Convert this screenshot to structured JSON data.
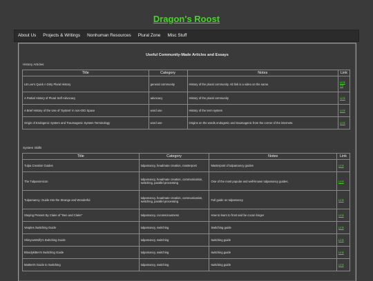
{
  "site": {
    "title": "Dragon's Roost"
  },
  "nav": [
    {
      "label": "About Us"
    },
    {
      "label": "Projects & Writings"
    },
    {
      "label": "Nonhuman Resources"
    },
    {
      "label": "Plural Zone"
    },
    {
      "label": "Misc Stuff"
    }
  ],
  "heading": "Useful Community-Made Articles and Essays",
  "history": {
    "label": "History Articles",
    "headers": {
      "title": "Title",
      "category": "Category",
      "notes": "Notes",
      "link": "Link"
    },
    "rows": [
      {
        "title": "LB Lee's Quick n Dirty Plural History",
        "category": "general community",
        "notes": "History of the plural community. Alt link is a video on the same.",
        "links": [
          "Link",
          "Alt"
        ]
      },
      {
        "title": "A Partial History of Plural Self-Advocacy",
        "category": "advocacy",
        "notes": "History of the plural community",
        "links": [
          "Link"
        ]
      },
      {
        "title": "A Brief History of the Use of 'System' in non-DID Space",
        "category": "word use",
        "notes": "History of the term system",
        "links": [
          "Link"
        ]
      },
      {
        "title": "Origin of Endogenic System and Traumagenic System Terminology",
        "category": "word use",
        "notes": "Origins on the words endogenic and traumagenic from the corner of the internets.",
        "links": [
          "Link"
        ]
      }
    ]
  },
  "skills": {
    "label": "System Skills",
    "headers": {
      "title": "Title",
      "category": "Category",
      "notes": "Notes",
      "link": "Link"
    },
    "rows": [
      {
        "title": "Tulpa Creation Guides",
        "category": "tulpamancy, headmate creation, masterpost",
        "notes": "Masterpost of tulpamancy guides",
        "links": [
          "Link"
        ]
      },
      {
        "title": "The Tulpanomicon",
        "category": "tulpamancy, headmate creation, communication, switching, parallel processing",
        "notes": "One of the most popular and well-known tulpamancy guides.",
        "links": [
          "Link"
        ]
      },
      {
        "title": "Tulpamancy: Guide Into the Strange and Wonderful",
        "category": "tulpamancy, headmate creation, communication, switching, parallel processing",
        "notes": "Full guide on tulpamancy",
        "links": [
          "Link"
        ]
      },
      {
        "title": "Staying Present By Claire of \"Ben and Claire\"",
        "category": "tulpamancy, coconsciousness",
        "notes": "How to learn to front and be cocon longer",
        "links": [
          "Link"
        ]
      },
      {
        "title": "Vesples Switching Guide",
        "category": "tulpamancy, switching",
        "notes": "Switching guide",
        "links": [
          "Link"
        ]
      },
      {
        "title": "ShinyouWolfy's Switching Guide",
        "category": "tulpamancy, switching",
        "notes": "switching guide",
        "links": [
          "Link"
        ]
      },
      {
        "title": "Bloodykitten's Switching Guide",
        "category": "tulpamancy, switching",
        "notes": "switching guide",
        "links": [
          "Link"
        ]
      },
      {
        "title": "Mattset's Guide to Switching",
        "category": "tulpamancy, switching",
        "notes": "switching guide",
        "links": [
          "Link"
        ]
      }
    ]
  },
  "colors": {
    "accent": "#3ddc1a",
    "background": "#3a3a3a",
    "navbar": "#2b2b2b"
  }
}
